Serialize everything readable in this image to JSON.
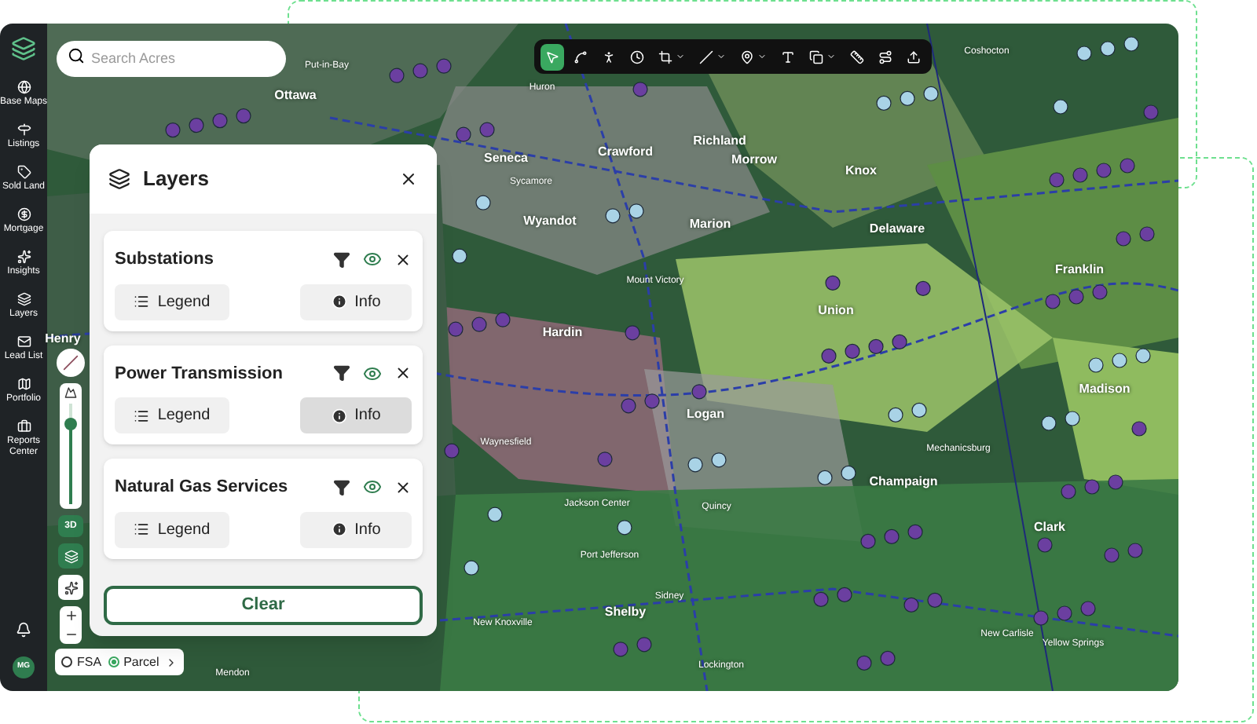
{
  "sidebar": {
    "items": [
      {
        "label": "Base Maps"
      },
      {
        "label": "Listings"
      },
      {
        "label": "Sold Land"
      },
      {
        "label": "Mortgage"
      },
      {
        "label": "Insights"
      },
      {
        "label": "Layers"
      },
      {
        "label": "Lead List"
      },
      {
        "label": "Portfolio"
      },
      {
        "label": "Reports Center"
      }
    ],
    "user_initials": "MG"
  },
  "search": {
    "placeholder": "Search Acres"
  },
  "toolbar": {
    "tools": [
      {
        "selected": true,
        "menu": false
      },
      {
        "selected": false,
        "menu": false
      },
      {
        "selected": false,
        "menu": false
      },
      {
        "selected": false,
        "menu": false
      },
      {
        "selected": false,
        "menu": true
      },
      {
        "selected": false,
        "menu": true
      },
      {
        "selected": false,
        "menu": true
      },
      {
        "selected": false,
        "menu": false
      },
      {
        "selected": false,
        "menu": true
      },
      {
        "selected": false,
        "menu": false
      },
      {
        "selected": false,
        "menu": false
      },
      {
        "selected": false,
        "menu": false
      }
    ]
  },
  "map_controls": {
    "level": 0.8,
    "three_d_label": "3D"
  },
  "base_toggle": {
    "options": [
      {
        "label": "FSA",
        "selected": false
      },
      {
        "label": "Parcel",
        "selected": true
      }
    ]
  },
  "layers_panel": {
    "title": "Layers",
    "layers": [
      {
        "name": "Substations",
        "visible": true,
        "legend_label": "Legend",
        "info_label": "Info",
        "info_active": false
      },
      {
        "name": "Power Transmission",
        "visible": true,
        "legend_label": "Legend",
        "info_label": "Info",
        "info_active": true
      },
      {
        "name": "Natural Gas Services",
        "visible": true,
        "legend_label": "Legend",
        "info_label": "Info",
        "info_active": false
      }
    ],
    "clear_label": "Clear"
  },
  "map_labels": [
    {
      "text": "Put-in-Bay",
      "kind": "town"
    },
    {
      "text": "Ottawa",
      "kind": "county"
    },
    {
      "text": "Huron",
      "kind": "town"
    },
    {
      "text": "Seneca",
      "kind": "county"
    },
    {
      "text": "Crawford",
      "kind": "county"
    },
    {
      "text": "Richland",
      "kind": "county"
    },
    {
      "text": "Knox",
      "kind": "county"
    },
    {
      "text": "Coshocton",
      "kind": "town"
    },
    {
      "text": "Morrow",
      "kind": "county"
    },
    {
      "text": "Sycamore",
      "kind": "town"
    },
    {
      "text": "Wyandot",
      "kind": "county"
    },
    {
      "text": "Marion",
      "kind": "county"
    },
    {
      "text": "Delaware",
      "kind": "county"
    },
    {
      "text": "Franklin",
      "kind": "county"
    },
    {
      "text": "Mount Victory",
      "kind": "town"
    },
    {
      "text": "Hardin",
      "kind": "county"
    },
    {
      "text": "Union",
      "kind": "county"
    },
    {
      "text": "Madison",
      "kind": "county"
    },
    {
      "text": "Logan",
      "kind": "county"
    },
    {
      "text": "Waynesfield",
      "kind": "town"
    },
    {
      "text": "Mechanicsburg",
      "kind": "town"
    },
    {
      "text": "Champaign",
      "kind": "county"
    },
    {
      "text": "Jackson Center",
      "kind": "town"
    },
    {
      "text": "Quincy",
      "kind": "town"
    },
    {
      "text": "Clark",
      "kind": "county"
    },
    {
      "text": "Port Jefferson",
      "kind": "town"
    },
    {
      "text": "Sidney",
      "kind": "town"
    },
    {
      "text": "Shelby",
      "kind": "county"
    },
    {
      "text": "New Knoxville",
      "kind": "town"
    },
    {
      "text": "New Carlisle",
      "kind": "town"
    },
    {
      "text": "Yellow Springs",
      "kind": "town"
    },
    {
      "text": "Lockington",
      "kind": "town"
    },
    {
      "text": "Mendon",
      "kind": "town"
    },
    {
      "text": "Henry",
      "kind": "county"
    }
  ]
}
